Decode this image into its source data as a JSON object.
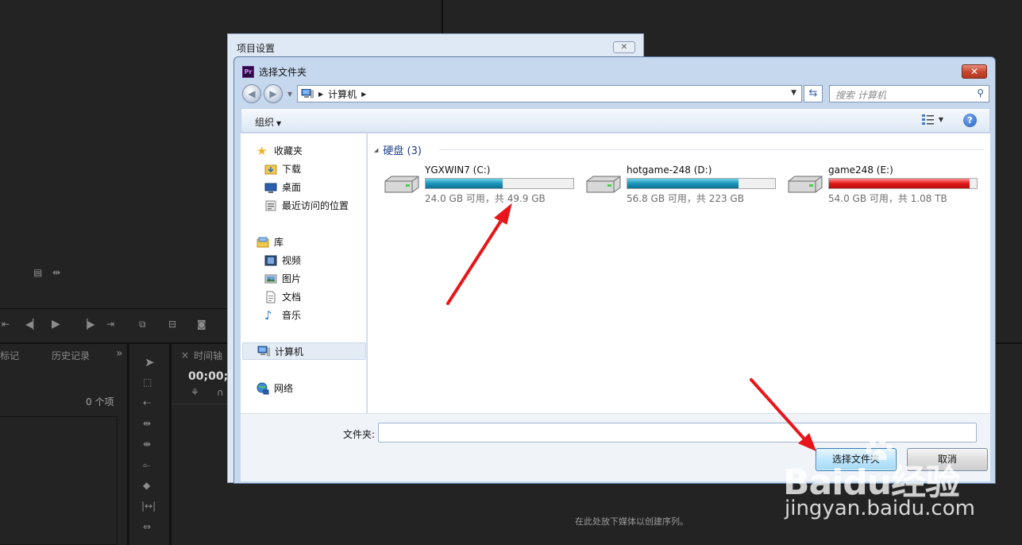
{
  "background": {
    "panel_tab_markers": "标记",
    "panel_tab_history": "历史记录",
    "panel_more": "»",
    "items_count": "0 个项",
    "timeline_close": "×",
    "timeline_tab": "时间轴",
    "timecode": "00;00;",
    "drop_hint": "在此处放下媒体以创建序列。"
  },
  "back_dialog": {
    "title": "项目设置",
    "close_label": "✕"
  },
  "dialog": {
    "app_icon_text": "Pr",
    "title": "选择文件夹",
    "close_label": "✕",
    "address": {
      "crumb": "计算机"
    },
    "search_placeholder": "搜索 计算机",
    "toolbar": {
      "organize_label": "组织",
      "help_label": "?"
    },
    "nav": {
      "favorites": "收藏夹",
      "downloads": "下载",
      "desktop": "桌面",
      "recent": "最近访问的位置",
      "libraries": "库",
      "videos": "视频",
      "pictures": "图片",
      "documents": "文档",
      "music": "音乐",
      "computer": "计算机",
      "network": "网络"
    },
    "group_header": "硬盘 (3)",
    "drives": [
      {
        "name": "YGXWIN7 (C:)",
        "free_text": "24.0 GB 可用，共 49.9 GB",
        "used_fraction": 0.52,
        "status_color": "#1b95b8"
      },
      {
        "name": "hotgame-248 (D:)",
        "free_text": "56.8 GB 可用，共 223 GB",
        "used_fraction": 0.75,
        "status_color": "#1b95b8"
      },
      {
        "name": "game248 (E:)",
        "free_text": "54.0 GB 可用，共 1.08 TB",
        "used_fraction": 0.95,
        "status_color": "#e01818"
      }
    ],
    "folder_label": "文件夹:",
    "folder_value": "",
    "select_button": "选择文件夹",
    "cancel_button": "取消"
  },
  "watermark": {
    "logo_text": "Baidu经验",
    "url_text": "jingyan.baidu.com"
  },
  "annotation_color": "#e8161b"
}
